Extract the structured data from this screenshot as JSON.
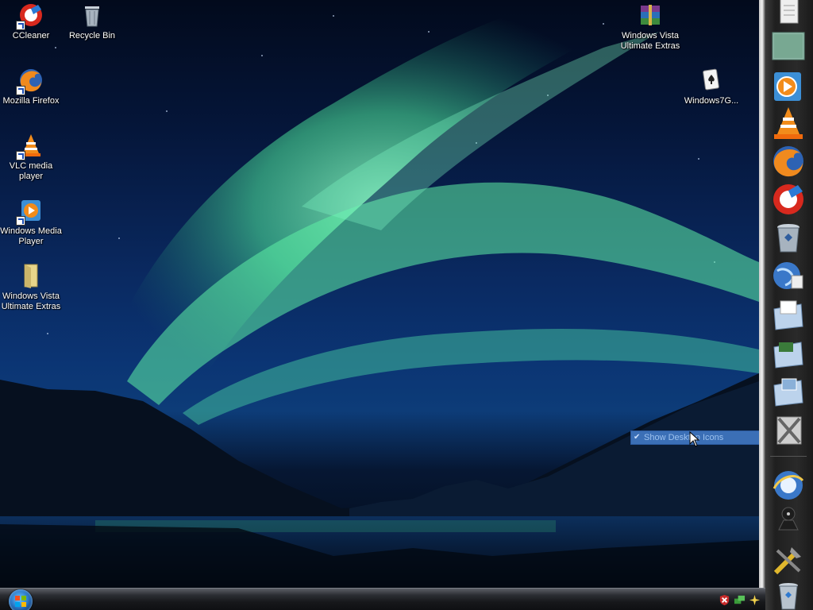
{
  "desktop": {
    "left_icons": [
      {
        "label": "CCleaner",
        "icon": "ccleaner-icon"
      },
      {
        "label": "Recycle Bin",
        "icon": "recycle-bin-icon"
      },
      {
        "label": "Mozilla Firefox",
        "icon": "firefox-icon"
      },
      {
        "label": "VLC media player",
        "icon": "vlc-icon"
      },
      {
        "label": "Windows Media Player",
        "icon": "media-player-icon"
      },
      {
        "label": "Windows Vista Ultimate Extras",
        "icon": "folder-icon"
      }
    ],
    "right_icons": [
      {
        "label": "Windows Vista Ultimate Extras",
        "icon": "winrar-archive-icon"
      },
      {
        "label": "Windows7G...",
        "icon": "solitaire-icon"
      }
    ]
  },
  "context_menu": {
    "item_label": "Show Desktop Icons",
    "checked": true
  },
  "dock": {
    "items": [
      "notepad-icon",
      "desktop-folder-icon",
      "media-player-icon",
      "vlc-icon",
      "firefox-icon",
      "ccleaner-icon",
      "recycle-bin-icon",
      "network-globe-icon",
      "documents-folder-icon",
      "programs-folder-icon",
      "pictures-folder-icon",
      "tools-icon",
      "internet-explorer-icon",
      "system-icon",
      "settings-tools-icon",
      "recycle-bin-icon"
    ]
  },
  "taskbar": {
    "tray_icons": [
      "security-alert-icon",
      "network-icon",
      "sparkle-icon"
    ]
  },
  "colors": {
    "aurora": "#5ef0a6",
    "sky": "#0b3574",
    "taskbar": "#17181b",
    "menu_highlight": "#3b6fb6"
  }
}
